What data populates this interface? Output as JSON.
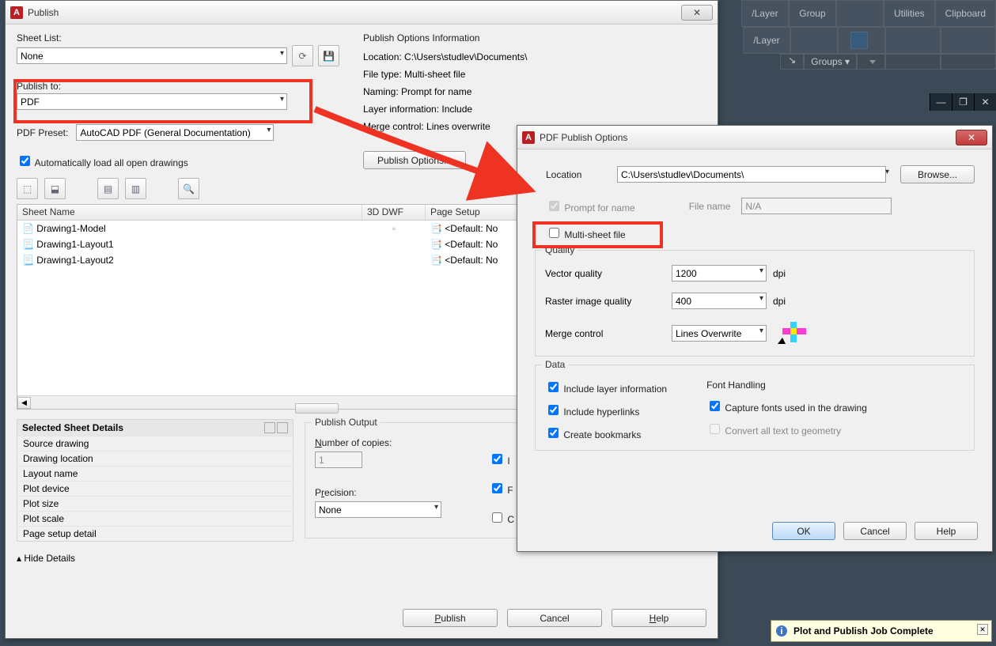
{
  "ribbon": {
    "items_row1": [
      "/Layer",
      "Group",
      "",
      "Utilities",
      "Clipboard"
    ],
    "items_row2_left": "/Layer",
    "groups_label": "Groups ▾"
  },
  "publish_dialog": {
    "title": "Publish",
    "sheet_list_label": "Sheet List:",
    "sheet_list_value": "None",
    "publish_to_label": "Publish to:",
    "publish_to_value": "PDF",
    "pdf_preset_label": "PDF Preset:",
    "pdf_preset_value": "AutoCAD PDF (General Documentation)",
    "auto_load_label": "Automatically load all open drawings",
    "options_info_title": "Publish Options Information",
    "info_lines": [
      "Location: C:\\Users\\studlev\\Documents\\",
      "File type: Multi-sheet file",
      "Naming: Prompt for name",
      "Layer information: Include",
      "Merge control: Lines overwrite"
    ],
    "publish_options_btn": "Publish Options...",
    "list_headers": {
      "name": "Sheet Name",
      "dwf": "3D DWF",
      "page": "Page Setup"
    },
    "rows": [
      {
        "name": "Drawing1-Model",
        "page": "<Default: No"
      },
      {
        "name": "Drawing1-Layout1",
        "page": "<Default: No"
      },
      {
        "name": "Drawing1-Layout2",
        "page": "<Default: No"
      }
    ],
    "details_title": "Selected Sheet Details",
    "details_rows": [
      "Source drawing",
      "Drawing location",
      "Layout name",
      "Plot device",
      "Plot size",
      "Plot scale",
      "Page setup detail"
    ],
    "hide_details": "Hide Details",
    "output_title": "Publish Output",
    "num_copies_label": "Number of copies:",
    "num_copies_value": "1",
    "precision_label": "Precision:",
    "precision_value": "None",
    "buttons": {
      "publish": "Publish",
      "cancel": "Cancel",
      "help": "Help"
    }
  },
  "pdf_dialog": {
    "title": "PDF Publish Options",
    "location_label": "Location",
    "location_value": "C:\\Users\\studlev\\Documents\\",
    "browse": "Browse...",
    "prompt_name": "Prompt for name",
    "filename_label": "File name",
    "filename_value": "N/A",
    "multisheet": "Multi-sheet file",
    "quality_title": "Quality",
    "vector_label": "Vector quality",
    "vector_value": "1200",
    "raster_label": "Raster image quality",
    "raster_value": "400",
    "dpi": "dpi",
    "merge_label": "Merge control",
    "merge_value": "Lines Overwrite",
    "data_title": "Data",
    "inc_layer": "Include layer information",
    "inc_hyper": "Include hyperlinks",
    "inc_book": "Create bookmarks",
    "font_title": "Font Handling",
    "capture_fonts": "Capture fonts used in the drawing",
    "convert_text": "Convert all text to geometry",
    "ok": "OK",
    "cancel": "Cancel",
    "help": "Help"
  },
  "notification": {
    "text": "Plot and Publish Job Complete"
  }
}
